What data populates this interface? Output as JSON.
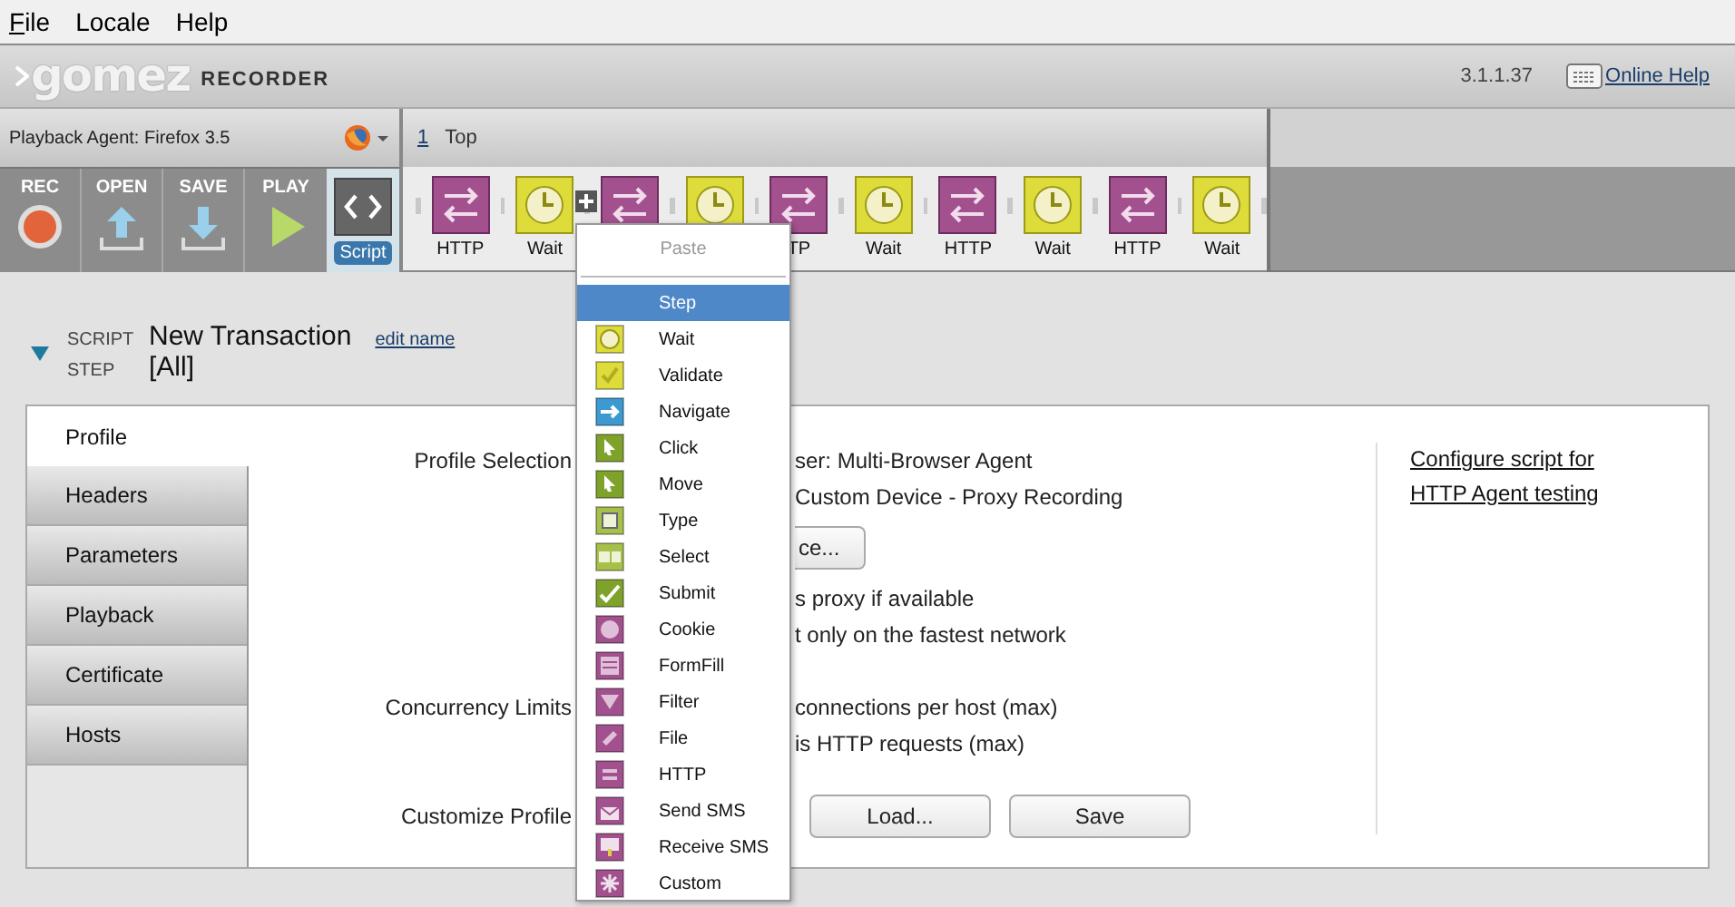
{
  "menu_bar": [
    {
      "label": "File",
      "mnemonic": true
    },
    {
      "label": "Locale",
      "mnemonic": false
    },
    {
      "label": "Help",
      "mnemonic": false
    }
  ],
  "header": {
    "logo": "gomez",
    "product": "RECORDER",
    "version": "3.1.1.37",
    "help_link": "Online Help"
  },
  "playback_agent": "Playback Agent: Firefox 3.5",
  "toolbar": [
    {
      "label": "REC",
      "kind": "rec"
    },
    {
      "label": "OPEN",
      "kind": "open"
    },
    {
      "label": "SAVE",
      "kind": "save"
    },
    {
      "label": "PLAY",
      "kind": "play"
    }
  ],
  "script_button": {
    "label": "Script",
    "selected": true
  },
  "page_tab": {
    "number": "1",
    "title": "Top"
  },
  "steps": [
    {
      "kind": "http",
      "label": "HTTP"
    },
    {
      "kind": "wait",
      "label": "Wait"
    },
    {
      "kind": "http"
    },
    {
      "kind": "wait"
    },
    {
      "kind": "http",
      "label": "TP"
    },
    {
      "kind": "wait",
      "label": "Wait"
    },
    {
      "kind": "http",
      "label": "HTTP"
    },
    {
      "kind": "wait",
      "label": "Wait"
    },
    {
      "kind": "http",
      "label": "HTTP"
    },
    {
      "kind": "wait",
      "label": "Wait"
    }
  ],
  "script_info": {
    "script_caption": "SCRIPT",
    "script_name": "New Transaction",
    "edit_link": "edit name",
    "step_caption": "STEP",
    "step_value": "[All]",
    "expanded": true
  },
  "tabs": [
    {
      "label": "Profile",
      "selected": true
    },
    {
      "label": "Headers",
      "selected": false
    },
    {
      "label": "Parameters",
      "selected": false
    },
    {
      "label": "Playback",
      "selected": false
    },
    {
      "label": "Certificate",
      "selected": false
    },
    {
      "label": "Hosts",
      "selected": false
    }
  ],
  "settings": [
    {
      "label": "Profile Selection",
      "items": [
        {
          "kind": "text",
          "text": "ser: Multi-Browser Agent"
        },
        {
          "kind": "text",
          "text": "Custom Device - Proxy Recording"
        },
        {
          "kind": "button",
          "text": "ce..."
        },
        {
          "kind": "text",
          "text": "s proxy if available"
        },
        {
          "kind": "text",
          "text": "t only on the fastest network"
        }
      ]
    },
    {
      "label": "Concurrency Limits",
      "items": [
        {
          "kind": "text",
          "text": "connections per host (max)"
        },
        {
          "kind": "text",
          "text": "is HTTP requests (max)"
        }
      ]
    },
    {
      "label": "Customize Profile",
      "items": [
        {
          "kind": "buttons",
          "buttons": [
            "Load...",
            "Save"
          ]
        }
      ]
    }
  ],
  "side_link": [
    "Configure script for",
    "HTTP Agent testing"
  ],
  "context_menu": {
    "paste": {
      "label": "Paste",
      "disabled": true
    },
    "items": [
      {
        "label": "Step",
        "kind": "none",
        "selected": true
      },
      {
        "label": "Wait",
        "kind": "wait",
        "selected": false
      },
      {
        "label": "Validate",
        "kind": "validate",
        "selected": false
      },
      {
        "label": "Navigate",
        "kind": "navigate",
        "selected": false
      },
      {
        "label": "Click",
        "kind": "click",
        "selected": false
      },
      {
        "label": "Move",
        "kind": "move",
        "selected": false
      },
      {
        "label": "Type",
        "kind": "type",
        "selected": false
      },
      {
        "label": "Select",
        "kind": "select",
        "selected": false
      },
      {
        "label": "Submit",
        "kind": "submit",
        "selected": false
      },
      {
        "label": "Cookie",
        "kind": "cookie",
        "selected": false
      },
      {
        "label": "FormFill",
        "kind": "formfill",
        "selected": false
      },
      {
        "label": "Filter",
        "kind": "filter",
        "selected": false
      },
      {
        "label": "File",
        "kind": "file",
        "selected": false
      },
      {
        "label": "HTTP",
        "kind": "http",
        "selected": false
      },
      {
        "label": "Send SMS",
        "kind": "sendsms",
        "selected": false
      },
      {
        "label": "Receive SMS",
        "kind": "receivesms",
        "selected": false
      },
      {
        "label": "Custom",
        "kind": "custom",
        "selected": false
      }
    ]
  }
}
